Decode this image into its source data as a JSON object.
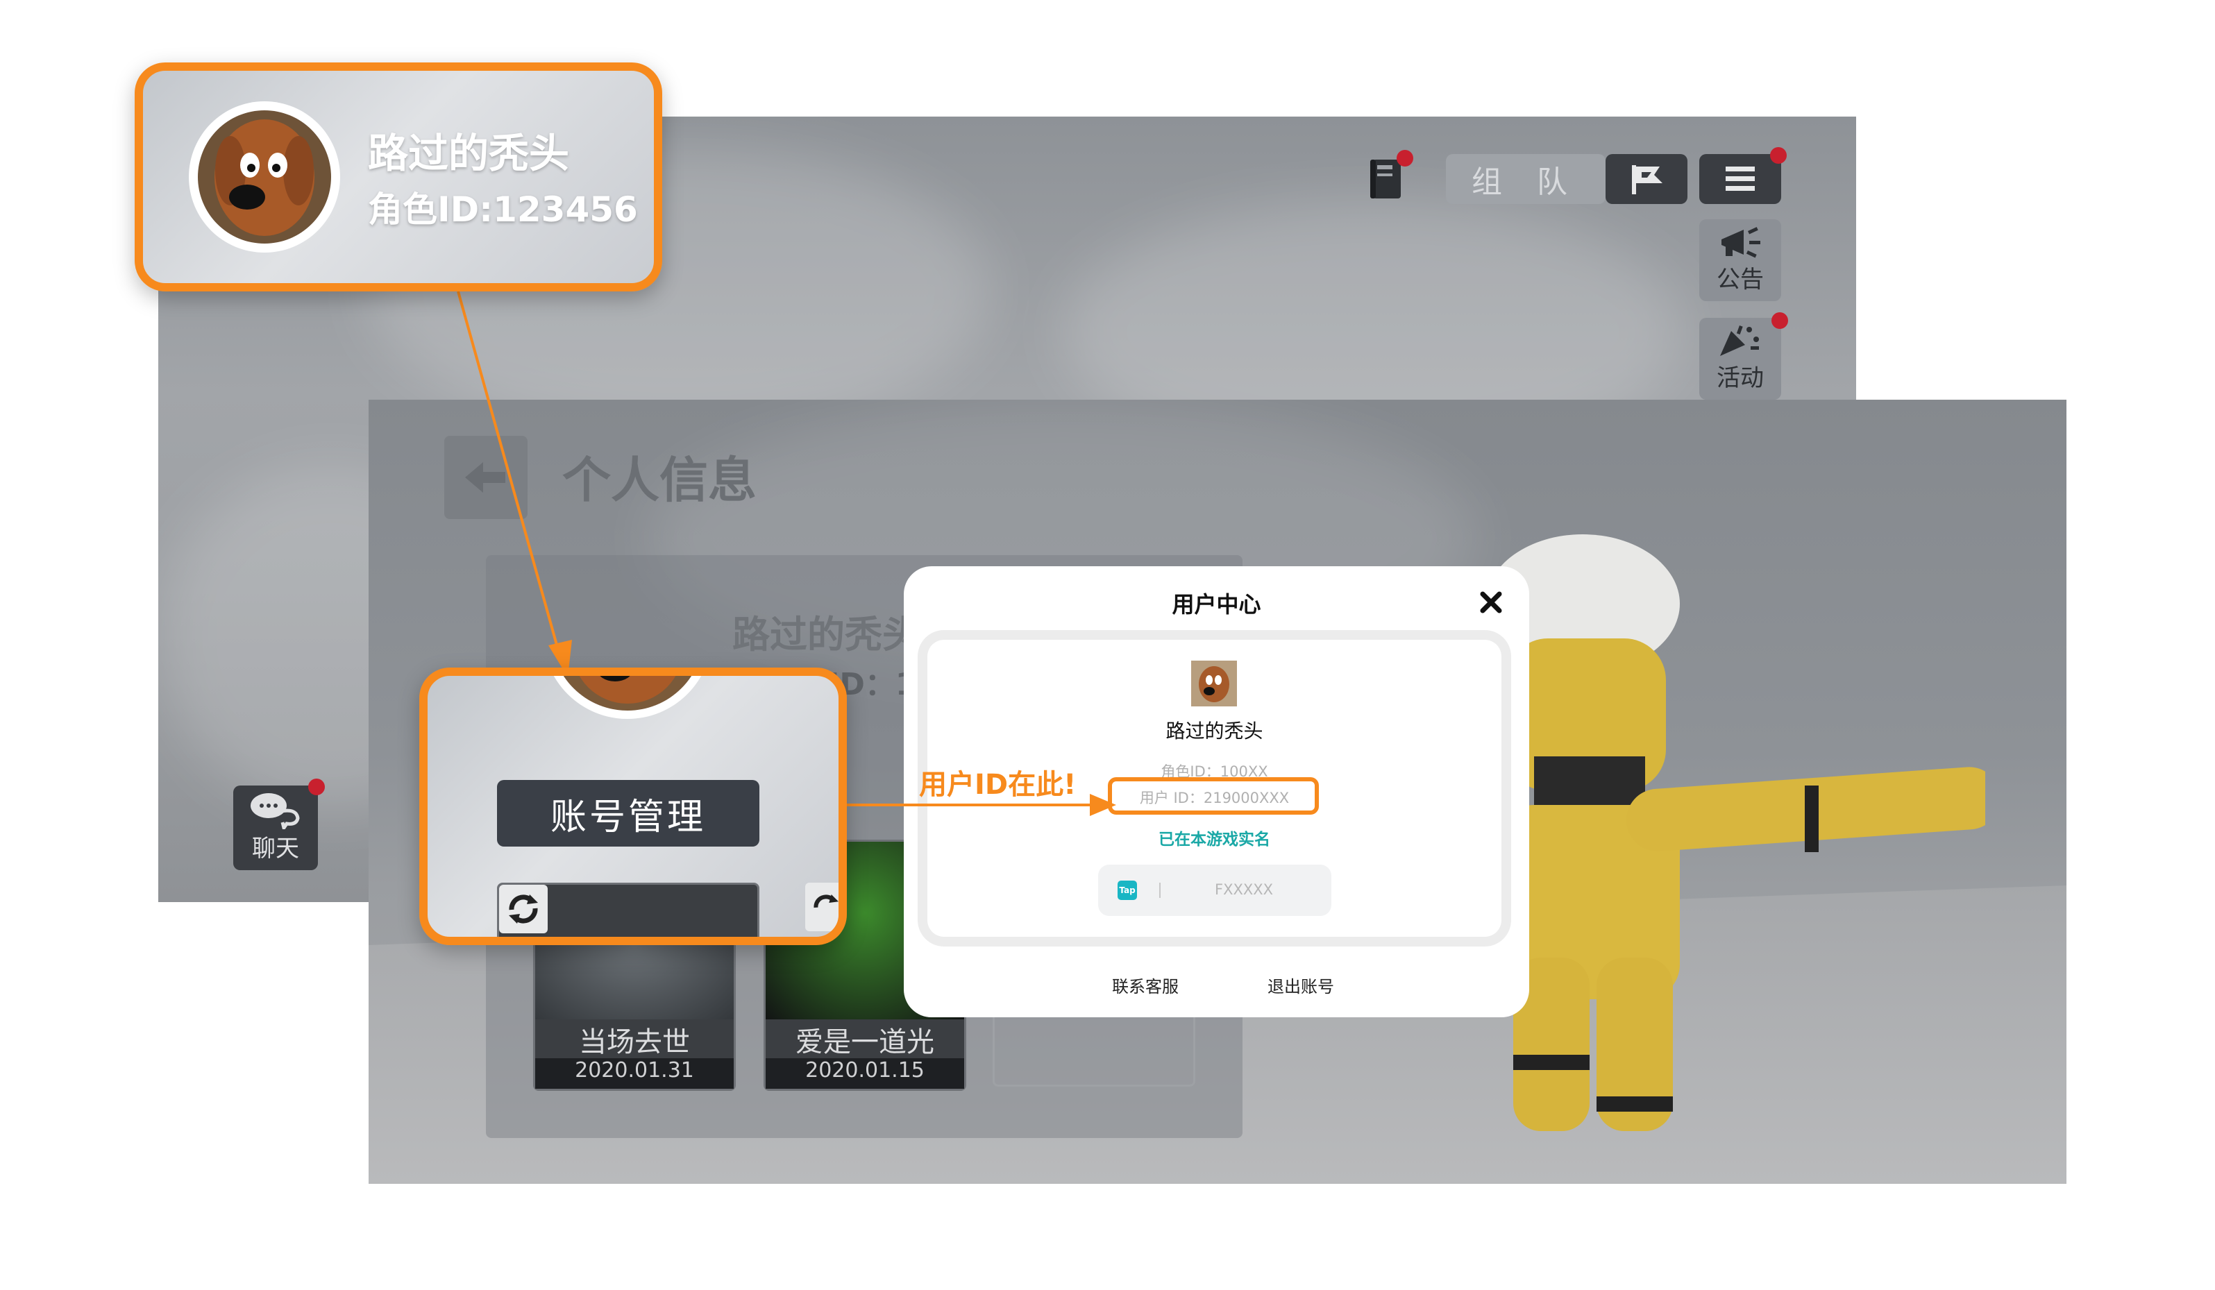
{
  "back_screen": {
    "team_label": "组 队",
    "announcement_label": "公告",
    "activity_label": "活动",
    "chat_label": "聊天"
  },
  "front_screen": {
    "page_title": "个人信息",
    "player_name_partial": "路过的秃头",
    "role_id_partial": "角色ID：100X",
    "account_manage_label": "账号管理",
    "achievements": [
      {
        "title": "当场去世",
        "date": "2020.01.31"
      },
      {
        "title": "爱是一道光",
        "date": "2020.01.15"
      }
    ]
  },
  "user_center": {
    "title": "用户中心",
    "name": "路过的秃头",
    "role_id": "角色ID：100XX",
    "user_id": "用户 ID：219000XXX",
    "realname_status": "已在本游戏实名",
    "tap_badge": "Tap",
    "tap_account": "FXXXXX",
    "contact_support": "联系客服",
    "logout": "退出账号"
  },
  "callouts": {
    "top": {
      "name": "路过的秃头",
      "role_id": "角色ID:123456"
    },
    "bottom": {
      "button_label": "账号管理"
    },
    "user_id_hint": "用户ID在此!"
  },
  "colors": {
    "accent_orange": "#f78a1d",
    "teal": "#1aa8a6",
    "notify_red": "#c8202e"
  }
}
